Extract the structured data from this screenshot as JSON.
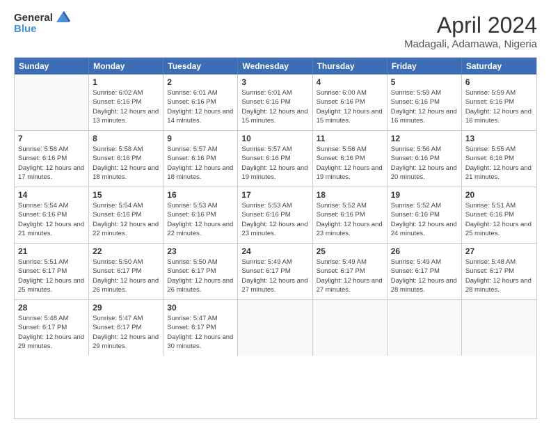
{
  "logo": {
    "line1": "General",
    "line2": "Blue",
    "icon_color": "#4a90d9"
  },
  "title": "April 2024",
  "subtitle": "Madagali, Adamawa, Nigeria",
  "header_days": [
    "Sunday",
    "Monday",
    "Tuesday",
    "Wednesday",
    "Thursday",
    "Friday",
    "Saturday"
  ],
  "weeks": [
    [
      {
        "day": "",
        "empty": true
      },
      {
        "day": "1",
        "sunrise": "6:02 AM",
        "sunset": "6:16 PM",
        "daylight": "12 hours and 13 minutes."
      },
      {
        "day": "2",
        "sunrise": "6:01 AM",
        "sunset": "6:16 PM",
        "daylight": "12 hours and 14 minutes."
      },
      {
        "day": "3",
        "sunrise": "6:01 AM",
        "sunset": "6:16 PM",
        "daylight": "12 hours and 15 minutes."
      },
      {
        "day": "4",
        "sunrise": "6:00 AM",
        "sunset": "6:16 PM",
        "daylight": "12 hours and 15 minutes."
      },
      {
        "day": "5",
        "sunrise": "5:59 AM",
        "sunset": "6:16 PM",
        "daylight": "12 hours and 16 minutes."
      },
      {
        "day": "6",
        "sunrise": "5:59 AM",
        "sunset": "6:16 PM",
        "daylight": "12 hours and 16 minutes."
      }
    ],
    [
      {
        "day": "7",
        "sunrise": "5:58 AM",
        "sunset": "6:16 PM",
        "daylight": "12 hours and 17 minutes."
      },
      {
        "day": "8",
        "sunrise": "5:58 AM",
        "sunset": "6:16 PM",
        "daylight": "12 hours and 18 minutes."
      },
      {
        "day": "9",
        "sunrise": "5:57 AM",
        "sunset": "6:16 PM",
        "daylight": "12 hours and 18 minutes."
      },
      {
        "day": "10",
        "sunrise": "5:57 AM",
        "sunset": "6:16 PM",
        "daylight": "12 hours and 19 minutes."
      },
      {
        "day": "11",
        "sunrise": "5:56 AM",
        "sunset": "6:16 PM",
        "daylight": "12 hours and 19 minutes."
      },
      {
        "day": "12",
        "sunrise": "5:56 AM",
        "sunset": "6:16 PM",
        "daylight": "12 hours and 20 minutes."
      },
      {
        "day": "13",
        "sunrise": "5:55 AM",
        "sunset": "6:16 PM",
        "daylight": "12 hours and 21 minutes."
      }
    ],
    [
      {
        "day": "14",
        "sunrise": "5:54 AM",
        "sunset": "6:16 PM",
        "daylight": "12 hours and 21 minutes."
      },
      {
        "day": "15",
        "sunrise": "5:54 AM",
        "sunset": "6:16 PM",
        "daylight": "12 hours and 22 minutes."
      },
      {
        "day": "16",
        "sunrise": "5:53 AM",
        "sunset": "6:16 PM",
        "daylight": "12 hours and 22 minutes."
      },
      {
        "day": "17",
        "sunrise": "5:53 AM",
        "sunset": "6:16 PM",
        "daylight": "12 hours and 23 minutes."
      },
      {
        "day": "18",
        "sunrise": "5:52 AM",
        "sunset": "6:16 PM",
        "daylight": "12 hours and 23 minutes."
      },
      {
        "day": "19",
        "sunrise": "5:52 AM",
        "sunset": "6:16 PM",
        "daylight": "12 hours and 24 minutes."
      },
      {
        "day": "20",
        "sunrise": "5:51 AM",
        "sunset": "6:16 PM",
        "daylight": "12 hours and 25 minutes."
      }
    ],
    [
      {
        "day": "21",
        "sunrise": "5:51 AM",
        "sunset": "6:17 PM",
        "daylight": "12 hours and 25 minutes."
      },
      {
        "day": "22",
        "sunrise": "5:50 AM",
        "sunset": "6:17 PM",
        "daylight": "12 hours and 26 minutes."
      },
      {
        "day": "23",
        "sunrise": "5:50 AM",
        "sunset": "6:17 PM",
        "daylight": "12 hours and 26 minutes."
      },
      {
        "day": "24",
        "sunrise": "5:49 AM",
        "sunset": "6:17 PM",
        "daylight": "12 hours and 27 minutes."
      },
      {
        "day": "25",
        "sunrise": "5:49 AM",
        "sunset": "6:17 PM",
        "daylight": "12 hours and 27 minutes."
      },
      {
        "day": "26",
        "sunrise": "5:49 AM",
        "sunset": "6:17 PM",
        "daylight": "12 hours and 28 minutes."
      },
      {
        "day": "27",
        "sunrise": "5:48 AM",
        "sunset": "6:17 PM",
        "daylight": "12 hours and 28 minutes."
      }
    ],
    [
      {
        "day": "28",
        "sunrise": "5:48 AM",
        "sunset": "6:17 PM",
        "daylight": "12 hours and 29 minutes."
      },
      {
        "day": "29",
        "sunrise": "5:47 AM",
        "sunset": "6:17 PM",
        "daylight": "12 hours and 29 minutes."
      },
      {
        "day": "30",
        "sunrise": "5:47 AM",
        "sunset": "6:17 PM",
        "daylight": "12 hours and 30 minutes."
      },
      {
        "day": "",
        "empty": true
      },
      {
        "day": "",
        "empty": true
      },
      {
        "day": "",
        "empty": true
      },
      {
        "day": "",
        "empty": true
      }
    ]
  ],
  "labels": {
    "sunrise_prefix": "Sunrise: ",
    "sunset_prefix": "Sunset: ",
    "daylight_prefix": "Daylight: "
  }
}
